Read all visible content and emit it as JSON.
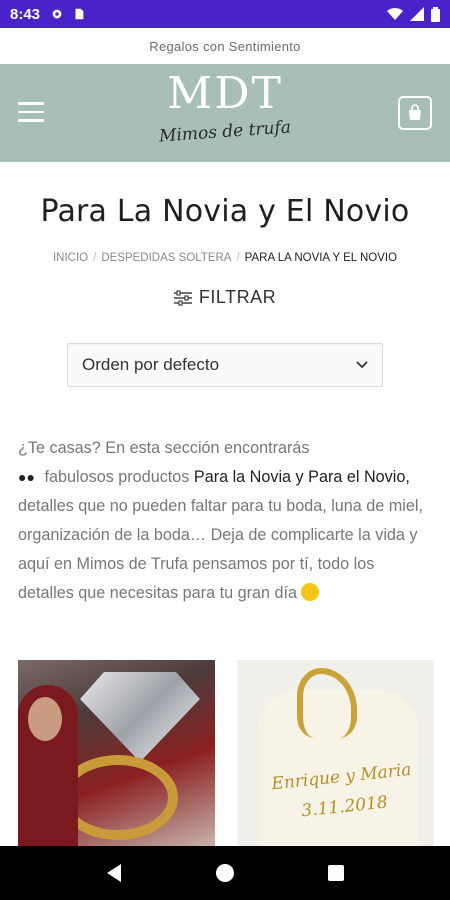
{
  "status_bar": {
    "time": "8:43",
    "icons_left": [
      "gear-icon",
      "sim-card-icon"
    ],
    "icons_right": [
      "wifi-icon",
      "signal-icon",
      "battery-icon"
    ],
    "color": "#4a22c9"
  },
  "top_bar": {
    "tagline": "Regalos con Sentimiento"
  },
  "header": {
    "background": "#a8bfb6",
    "logo_text": "MDT",
    "logo_script": "Mimos de trufa",
    "menu_icon": "hamburger-menu-icon",
    "cart_icon": "shopping-bag-icon"
  },
  "page": {
    "title": "Para La Novia y El Novio",
    "breadcrumb": {
      "items": [
        "INICIO",
        "DESPEDIDAS SOLTERA"
      ],
      "current": "PARA LA NOVIA Y EL NOVIO"
    },
    "filter_label": "FILTRAR",
    "sort_select": {
      "selected": "Orden por defecto"
    },
    "description": {
      "part1": "¿Te casas? En esta sección encontrarás",
      "part2": "fabulosos productos",
      "bold": "Para la Novia y Para el Novio,",
      "part3": "detalles que no pueden faltar para tu boda, luna de miel, organización de la boda… Deja de complicarte la vida y aquí en Mimos de Trufa pensamos por tí, todo los detalles que necesitas para tu gran día"
    },
    "products": [
      {
        "image": "bride-with-ring-balloon"
      },
      {
        "image": "gift-bag-enrique-y-maria",
        "image_text_1": "Enrique y Maria",
        "image_text_2": "3.11.2018"
      }
    ]
  },
  "nav_bar": {
    "buttons": [
      "back-icon",
      "home-icon",
      "recents-icon"
    ]
  }
}
